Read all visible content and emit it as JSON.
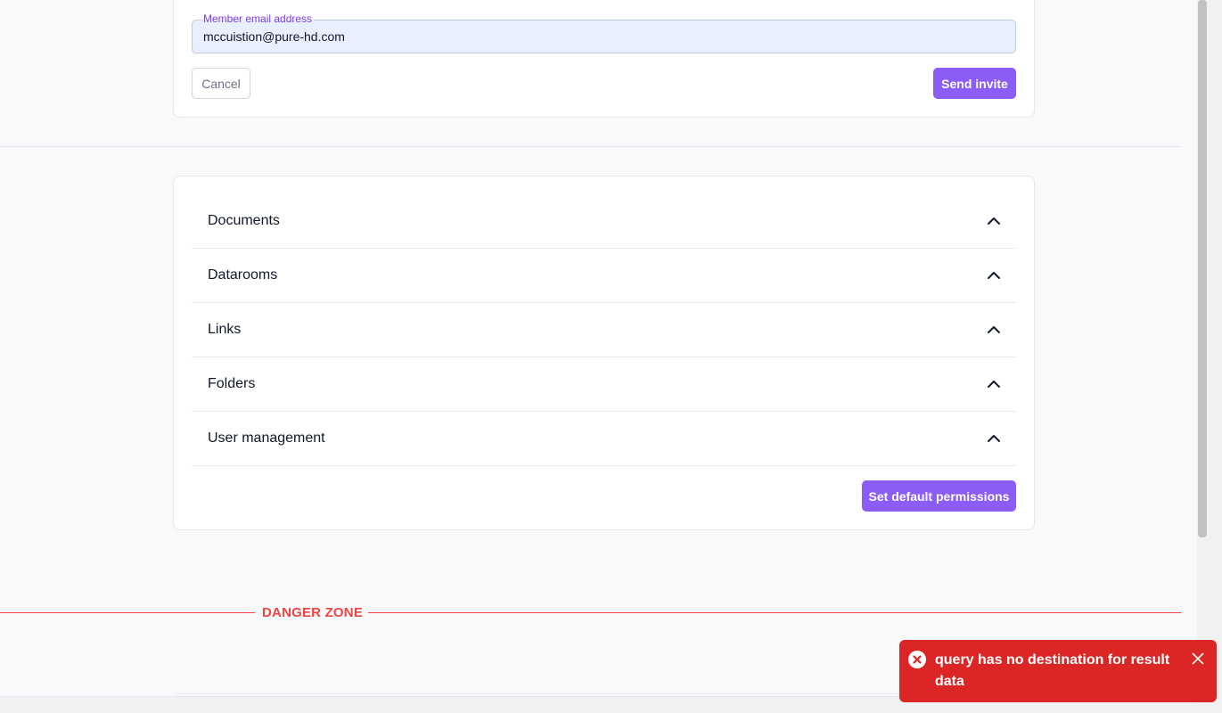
{
  "invite": {
    "email_label": "Member email address",
    "email_value": "mccuistion@pure-hd.com",
    "cancel_label": "Cancel",
    "send_label": "Send invite"
  },
  "permissions": {
    "sections": [
      {
        "label": "Documents",
        "icon": "chevron-up-icon"
      },
      {
        "label": "Datarooms",
        "icon": "chevron-up-icon"
      },
      {
        "label": "Links",
        "icon": "chevron-up-icon"
      },
      {
        "label": "Folders",
        "icon": "chevron-up-icon"
      },
      {
        "label": "User management",
        "icon": "chevron-up-icon"
      }
    ],
    "set_default_label": "Set default permissions"
  },
  "danger_zone": {
    "title": "DANGER ZONE"
  },
  "toast": {
    "message": "query has no destination for result data",
    "icon": "error-circle-icon",
    "close_icon": "close-icon"
  },
  "colors": {
    "accent": "#8b5cf6",
    "danger": "#ef4444",
    "toast_bg": "#dc2626",
    "field_bg": "#e8f0fe"
  }
}
